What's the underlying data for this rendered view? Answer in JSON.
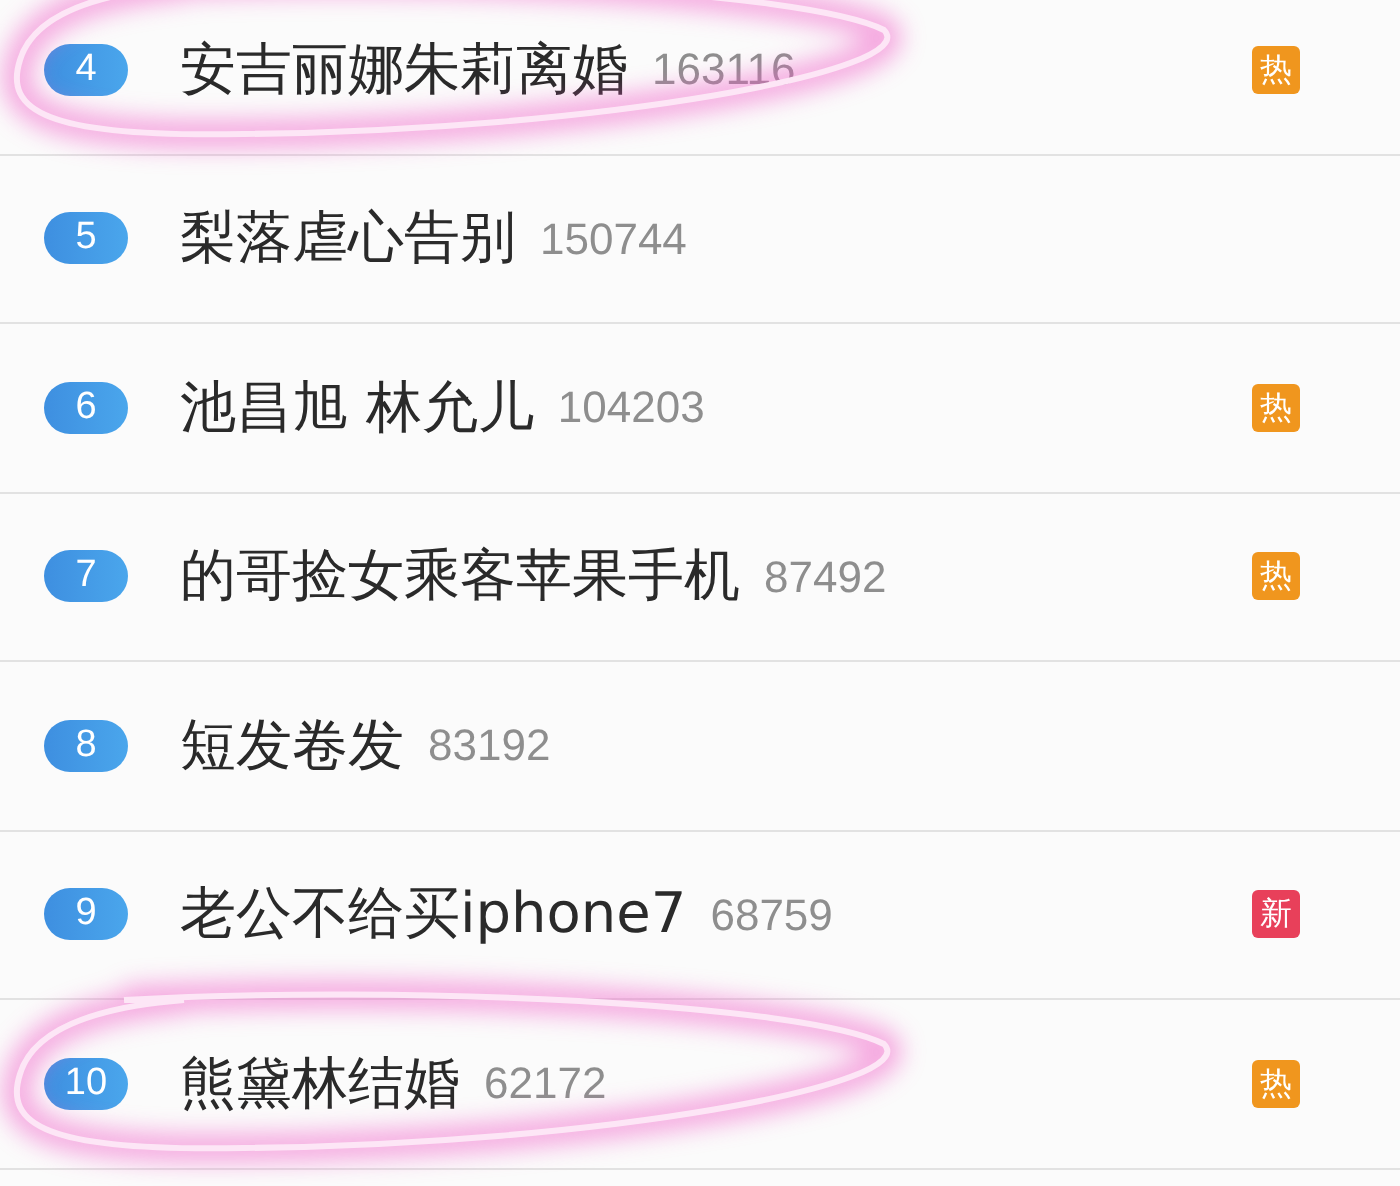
{
  "items": [
    {
      "rank": "4",
      "title": "安吉丽娜朱莉离婚",
      "count": "163116",
      "tag": {
        "text": "热",
        "color": "#f0961e"
      },
      "circled": true
    },
    {
      "rank": "5",
      "title": "梨落虐心告别",
      "count": "150744",
      "circled": false
    },
    {
      "rank": "6",
      "title": "池昌旭 林允儿",
      "count": "104203",
      "tag": {
        "text": "热",
        "color": "#f0961e"
      },
      "circled": false
    },
    {
      "rank": "7",
      "title": "的哥捡女乘客苹果手机",
      "count": "87492",
      "tag": {
        "text": "热",
        "color": "#f0961e"
      },
      "circled": false
    },
    {
      "rank": "8",
      "title": "短发卷发",
      "count": "83192",
      "circled": false
    },
    {
      "rank": "9",
      "title": "老公不给买iphone7",
      "count": "68759",
      "tag": {
        "text": "新",
        "color": "#e8405a"
      },
      "circled": false
    },
    {
      "rank": "10",
      "title": "熊黛林结婚",
      "count": "62172",
      "tag": {
        "text": "热",
        "color": "#f0961e"
      },
      "circled": true
    }
  ]
}
